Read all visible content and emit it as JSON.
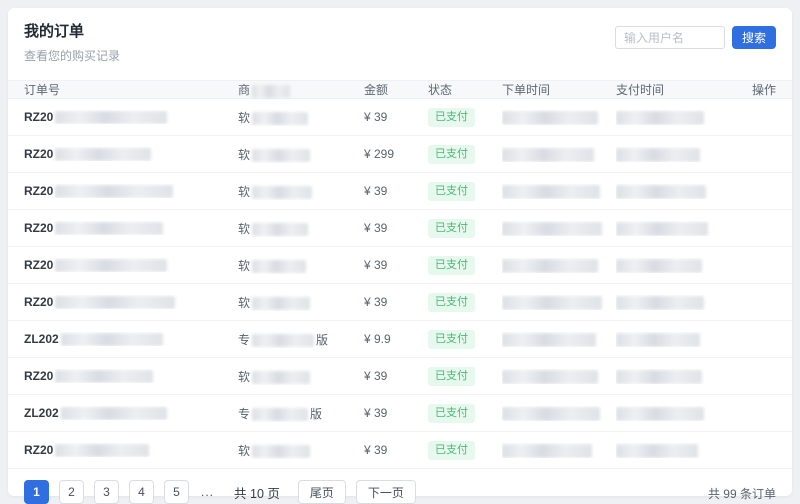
{
  "page": {
    "title": "我的订单",
    "subtitle": "查看您的购买记录"
  },
  "search": {
    "placeholder": "输入用户名",
    "button_label": "搜索"
  },
  "table": {
    "columns": [
      {
        "label": "订单号",
        "redacted_after": false
      },
      {
        "label": "商",
        "redacted_after": true
      },
      {
        "label": "金额",
        "redacted_after": false
      },
      {
        "label": "状态",
        "redacted_after": false
      },
      {
        "label": "下单时间",
        "redacted_after": false
      },
      {
        "label": "支付时间",
        "redacted_after": false
      },
      {
        "label": "操作",
        "redacted_after": false
      }
    ],
    "rows": [
      {
        "order_prefix": "RZ20",
        "product_prefix": "软",
        "product_suffix": "",
        "amount": "¥ 39",
        "status": "已支付"
      },
      {
        "order_prefix": "RZ20",
        "product_prefix": "软",
        "product_suffix": "",
        "amount": "¥ 299",
        "status": "已支付"
      },
      {
        "order_prefix": "RZ20",
        "product_prefix": "软",
        "product_suffix": "",
        "amount": "¥ 39",
        "status": "已支付"
      },
      {
        "order_prefix": "RZ20",
        "product_prefix": "软",
        "product_suffix": "",
        "amount": "¥ 39",
        "status": "已支付"
      },
      {
        "order_prefix": "RZ20",
        "product_prefix": "软",
        "product_suffix": "",
        "amount": "¥ 39",
        "status": "已支付"
      },
      {
        "order_prefix": "RZ20",
        "product_prefix": "软",
        "product_suffix": "",
        "amount": "¥ 39",
        "status": "已支付"
      },
      {
        "order_prefix": "ZL202",
        "product_prefix": "专",
        "product_suffix": "版",
        "amount": "¥ 9.9",
        "status": "已支付"
      },
      {
        "order_prefix": "RZ20",
        "product_prefix": "软",
        "product_suffix": "",
        "amount": "¥ 39",
        "status": "已支付"
      },
      {
        "order_prefix": "ZL202",
        "product_prefix": "专",
        "product_suffix": "版",
        "amount": "¥ 39",
        "status": "已支付"
      },
      {
        "order_prefix": "RZ20",
        "product_prefix": "软",
        "product_suffix": "",
        "amount": "¥ 39",
        "status": "已支付"
      }
    ]
  },
  "pagination": {
    "pages": [
      "1",
      "2",
      "3",
      "4",
      "5"
    ],
    "active_page": "1",
    "ellipsis": "...",
    "total_pages_label": "共 10 页",
    "last_label": "尾页",
    "next_label": "下一页",
    "total_orders_label": "共 99 条订单"
  },
  "colors": {
    "accent": "#2f6fe0",
    "status_badge_bg": "#e7f9ee",
    "status_badge_text": "#49b974",
    "page_background": "#eef0f4",
    "card_background": "#ffffff"
  }
}
